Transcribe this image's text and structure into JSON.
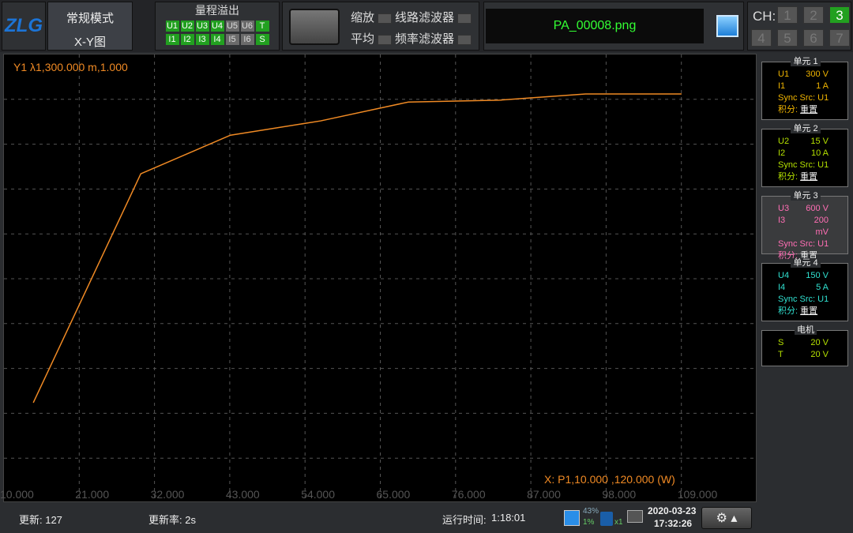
{
  "header": {
    "logo": "ZLG",
    "mode_line1": "常规模式",
    "mode_line2": "X-Y图",
    "overflow_title": "量程溢出",
    "overflow_u": [
      {
        "label": "U1",
        "on": true
      },
      {
        "label": "U2",
        "on": true
      },
      {
        "label": "U3",
        "on": true
      },
      {
        "label": "U4",
        "on": true
      },
      {
        "label": "U5",
        "on": false
      },
      {
        "label": "U6",
        "on": false
      },
      {
        "label": "T",
        "on": true
      }
    ],
    "overflow_i": [
      {
        "label": "I1",
        "on": true
      },
      {
        "label": "I2",
        "on": true
      },
      {
        "label": "I3",
        "on": true
      },
      {
        "label": "I4",
        "on": true
      },
      {
        "label": "I5",
        "on": false
      },
      {
        "label": "I6",
        "on": false
      },
      {
        "label": "S",
        "on": true
      }
    ],
    "zoom": "缩放",
    "average": "平均",
    "line_filter": "线路滤波器",
    "freq_filter": "频率滤波器",
    "filename": "PA_00008.png",
    "ch_label": "CH:",
    "channels": [
      "1",
      "2",
      "3",
      "4",
      "5",
      "6",
      "7"
    ],
    "active_channel": "3"
  },
  "plot": {
    "cursor_y": "Y1 λ1,300.000 m,1.000",
    "cursor_x": "X: P1,10.000 ,120.000 (W)",
    "line_color": "#f08a24"
  },
  "chart_data": {
    "type": "line",
    "x_ticks": [
      "10.000",
      "21.000",
      "32.000",
      "43.000",
      "54.000",
      "65.000",
      "76.000",
      "87.000",
      "98.000",
      "109.000"
    ],
    "xlim": [
      10,
      120
    ],
    "ylim": [
      0,
      10
    ],
    "x": [
      14.3,
      30.0,
      43.1,
      56.3,
      69.1,
      82.3,
      95.0,
      109.0
    ],
    "y": [
      2.24,
      7.34,
      8.2,
      8.52,
      8.94,
      8.98,
      9.12,
      9.12
    ]
  },
  "units": [
    {
      "title": "单元 1",
      "color": "#f0b400",
      "u": "U1",
      "uv": "300 V",
      "i": "I1",
      "iv": "1 A",
      "sync": "Sync Src: U1",
      "integ": "积分:",
      "integ_v": "重置"
    },
    {
      "title": "单元 2",
      "color": "#b4e000",
      "u": "U2",
      "uv": "15 V",
      "i": "I2",
      "iv": "10 A",
      "sync": "Sync Src: U1",
      "integ": "积分:",
      "integ_v": "重置"
    },
    {
      "title": "单元 3",
      "color": "#ff6eb4",
      "u": "U3",
      "uv": "600 V",
      "i": "I3",
      "iv": "200 mV",
      "sync": "Sync Src: U1",
      "integ": "积分:",
      "integ_v": "重置"
    },
    {
      "title": "单元 4",
      "color": "#30e0d0",
      "u": "U4",
      "uv": "150 V",
      "i": "I4",
      "iv": "5 A",
      "sync": "Sync Src: U1",
      "integ": "积分:",
      "integ_v": "重置"
    }
  ],
  "motor": {
    "title": "电机",
    "s": "S",
    "sv": "20 V",
    "t": "T",
    "tv": "20 V"
  },
  "status": {
    "update": "更新: 127",
    "rate": "更新率: 2s",
    "runtime_label": "运行时间:",
    "runtime": "1:18:01",
    "storage_pct": "43%",
    "cpu_pct": "1%",
    "usb_count": "x1",
    "date": "2020-03-23",
    "time": "17:32:26"
  }
}
